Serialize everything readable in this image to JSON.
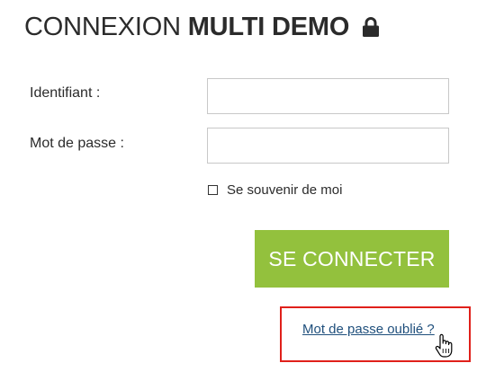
{
  "header": {
    "title_regular": "CONNEXION",
    "title_bold": "MULTI DEMO",
    "title_icon": "lock-icon"
  },
  "form": {
    "username_label": "Identifiant :",
    "username_value": "",
    "password_label": "Mot de passe :",
    "password_value": "",
    "remember_label": "Se souvenir de moi",
    "remember_checked": false,
    "submit_label": "SE CONNECTER",
    "forgot_label": "Mot de passe oublié ?"
  },
  "colors": {
    "submit_background": "#93c13d",
    "submit_text": "#ffffff",
    "link": "#1f4f7c",
    "highlight_border": "#e0201b",
    "text": "#2b2b2b"
  },
  "cursor": {
    "icon": "hand-pointer-icon"
  }
}
